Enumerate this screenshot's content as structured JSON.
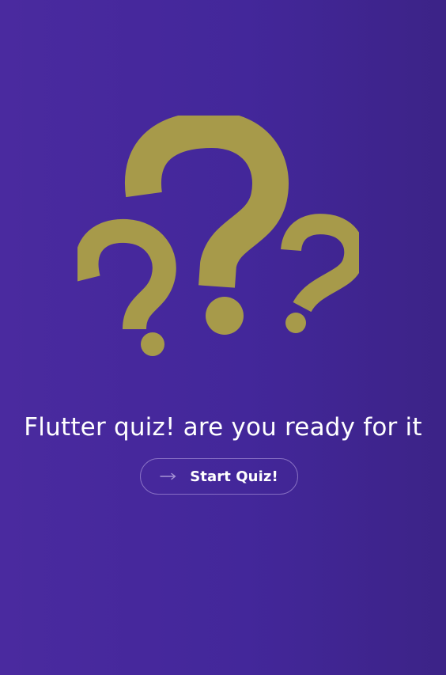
{
  "app": {
    "logo_icon": "question-marks-icon",
    "accent_color": "#a79a4a",
    "background_gradient": [
      "#4a2a9f",
      "#3c2387"
    ]
  },
  "main": {
    "title": "Flutter quiz! are you ready for it",
    "start_button": {
      "label": "Start Quiz!",
      "icon": "arrow-right-icon"
    }
  }
}
